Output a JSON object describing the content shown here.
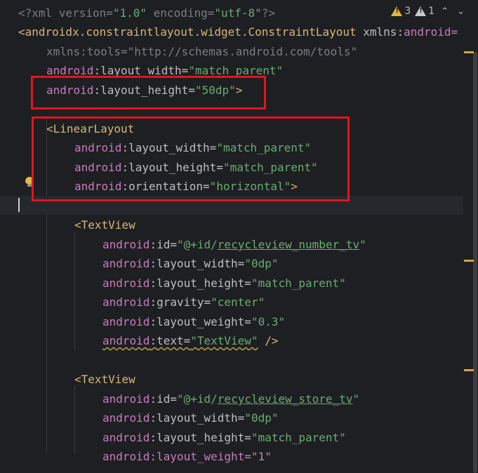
{
  "inspections": {
    "warnings": "3",
    "weak_warnings": "1"
  },
  "code": {
    "l1_pre": "<?xml version=",
    "l1_v1": "\"1.0\"",
    "l1_mid": " encoding=",
    "l1_v2": "\"utf-8\"",
    "l1_end": "?>",
    "l2_tag": "<androidx.constraintlayout.widget.ConstraintLayout",
    "l2_attr": " xmlns:",
    "l2_ns": "android=",
    "l3": "xmlns:tools=\"http://schemas.android.com/tools\"",
    "android": "android",
    "colon": ":",
    "layout_width": "layout_width=",
    "layout_height": "layout_height=",
    "orientation": "orientation=",
    "id": "id=",
    "gravity": "gravity=",
    "layout_weight": "layout_weight=",
    "text": "text=",
    "match_parent": "\"match_parent\"",
    "h50": "\"50dp\"",
    "close": ">",
    "linear_tag": "<LinearLayout",
    "horizontal": "\"horizontal\"",
    "textview_tag": "<TextView",
    "q": "\"",
    "id_prefix": "@+id/",
    "id_number": "recycleview_number_tv",
    "id_store": "recycleview_store_tv",
    "zero_dp": "\"0dp\"",
    "center": "\"center\"",
    "w03": "\"0.3\"",
    "text_val": "\"TextView\"",
    "self_close": " />",
    "partial": "android:layout_weight=\"1\""
  }
}
